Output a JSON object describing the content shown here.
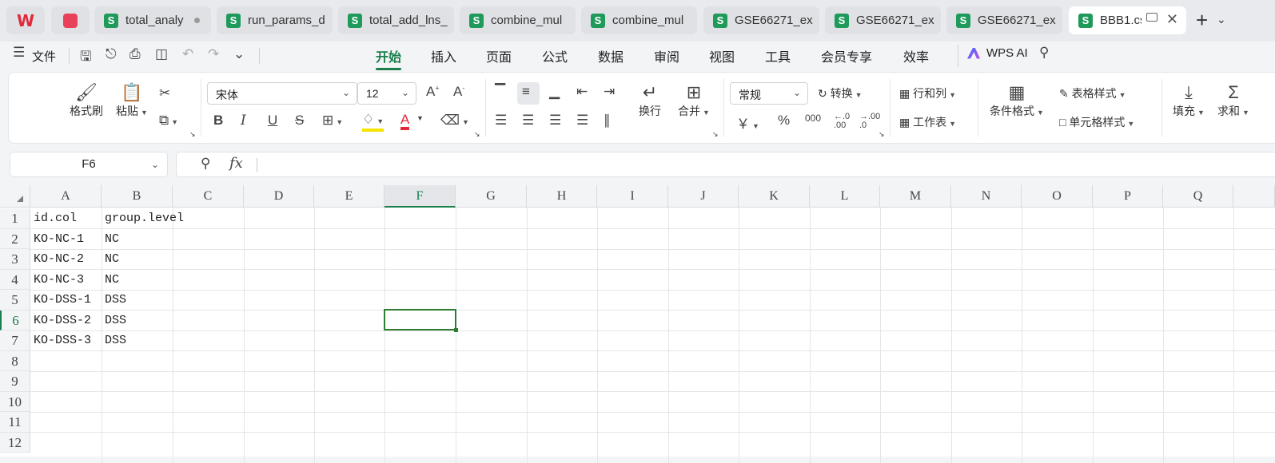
{
  "tabs": [
    {
      "label": "total_analy",
      "state": "unsaved"
    },
    {
      "label": "run_params_d"
    },
    {
      "label": "total_add_lns_"
    },
    {
      "label": "combine_mul"
    },
    {
      "label": "combine_mul"
    },
    {
      "label": "GSE66271_ex"
    },
    {
      "label": "GSE66271_ex"
    },
    {
      "label": "GSE66271_ex"
    },
    {
      "label": "BBB1.cs",
      "active": true
    }
  ],
  "tab_icon_letter": "S",
  "tab_close_glyph": "✕",
  "new_tab_glyph": "+",
  "menu": {
    "file": "文件",
    "tabs": [
      "开始",
      "插入",
      "页面",
      "公式",
      "数据",
      "审阅",
      "视图",
      "工具",
      "会员专享",
      "效率"
    ],
    "active_tab": "开始",
    "wps_ai": "WPS AI"
  },
  "ribbon": {
    "format_painter": "格式刷",
    "paste": "粘贴",
    "font_name": "宋体",
    "font_size": "12",
    "bold": "B",
    "italic": "I",
    "underline": "U",
    "strike": "S",
    "font_color_letter": "A",
    "font_color": "#e3283a",
    "highlight_color": "#f5e400",
    "wrap": "换行",
    "merge": "合并",
    "number_format": "常规",
    "convert": "转换",
    "currency": "￥",
    "percent": "%",
    "thousands": "000",
    "dec_increase": "←.0\n.00",
    "dec_decrease": "→.00\n.0",
    "row_col": "行和列",
    "worksheet": "工作表",
    "cond_format": "条件格式",
    "table_style": "表格样式",
    "cell_style": "单元格样式",
    "fill": "填充",
    "sum": "求和"
  },
  "formula_bar": {
    "name_box": "F6",
    "fx": "fx",
    "content": ""
  },
  "sheet": {
    "columns": [
      "A",
      "B",
      "C",
      "D",
      "E",
      "F",
      "G",
      "H",
      "I",
      "J",
      "K",
      "L",
      "M",
      "N",
      "O",
      "P",
      "Q"
    ],
    "rows": [
      "1",
      "2",
      "3",
      "4",
      "5",
      "6",
      "7",
      "8",
      "9",
      "10",
      "11",
      "12"
    ],
    "selected_column": "F",
    "selected_row": "6",
    "cells": [
      [
        "id.col",
        "group.level"
      ],
      [
        "KO-NC-1",
        "NC"
      ],
      [
        "KO-NC-2",
        "NC"
      ],
      [
        "KO-NC-3",
        "NC"
      ],
      [
        "KO-DSS-1",
        "DSS"
      ],
      [
        "KO-DSS-2",
        "DSS"
      ],
      [
        "KO-DSS-3",
        "DSS"
      ]
    ]
  },
  "colors": {
    "accent": "#1a7f4b",
    "sheet_icon": "#1f9a5b",
    "active_cell_border": "#2e7d32"
  }
}
